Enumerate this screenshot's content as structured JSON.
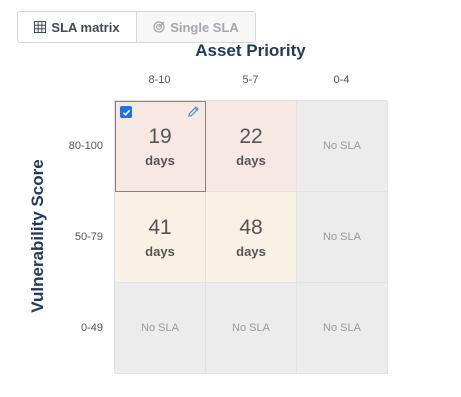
{
  "toggle": {
    "matrix_label": "SLA matrix",
    "single_label": "Single SLA"
  },
  "axis": {
    "x_title": "Asset Priority",
    "y_title": "Vulnerability Score",
    "columns": [
      "8-10",
      "5-7",
      "0-4"
    ],
    "rows": [
      "80-100",
      "50-79",
      "0-49"
    ]
  },
  "matrix": [
    [
      {
        "value": "19",
        "unit": "days",
        "severity": "red"
      },
      {
        "value": "22",
        "unit": "days",
        "severity": "red"
      },
      {
        "text": "No SLA",
        "severity": "none"
      }
    ],
    [
      {
        "value": "41",
        "unit": "days",
        "severity": "amber"
      },
      {
        "value": "48",
        "unit": "days",
        "severity": "amber"
      },
      {
        "text": "No SLA",
        "severity": "none"
      }
    ],
    [
      {
        "text": "No SLA",
        "severity": "none"
      },
      {
        "text": "No SLA",
        "severity": "none"
      },
      {
        "text": "No SLA",
        "severity": "none"
      }
    ]
  ],
  "colors": {
    "red": "#f8e8e4",
    "amber": "#f9f1e4",
    "none": "#ececec",
    "accent": "#1a73e8",
    "title": "#1f3a5f"
  },
  "icons": {
    "matrix": "grid-icon",
    "single": "target-icon",
    "checkbox": "checkbox-checked-icon",
    "edit": "pencil-icon"
  }
}
